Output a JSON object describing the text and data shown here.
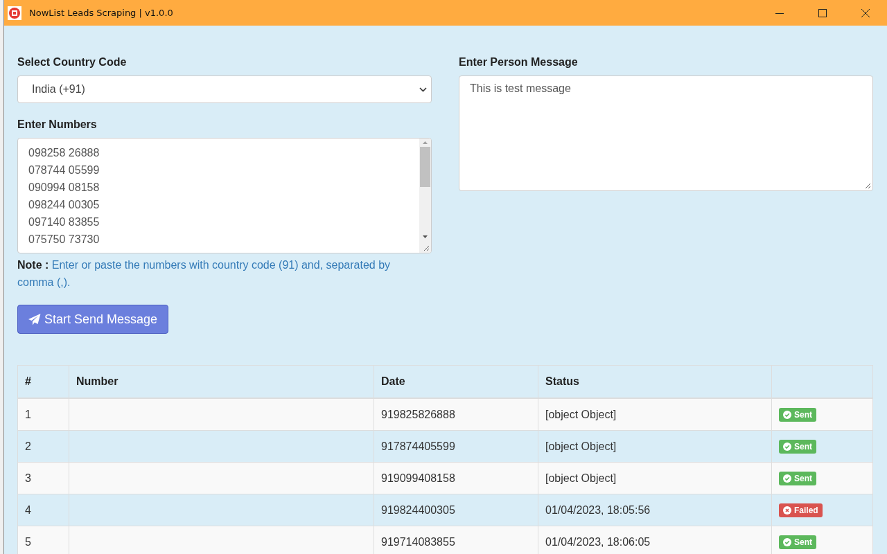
{
  "window": {
    "title": "NowList Leads Scraping | v1.0.0"
  },
  "country": {
    "label": "Select Country Code",
    "value": "India (+91)"
  },
  "numbers": {
    "label": "Enter Numbers",
    "lines": [
      "098258 26888",
      "078744 05599",
      "090994 08158",
      "098244 00305",
      "097140 83855",
      "075750 73730"
    ]
  },
  "note": {
    "label": "Note :",
    "text": "Enter or paste the numbers with country code (91) and, separated by comma (,)."
  },
  "send_button": "Start Send Message",
  "message": {
    "label": "Enter Person Message",
    "value": "This is test message"
  },
  "table": {
    "columns": [
      "#",
      "Number",
      "Date",
      "Status"
    ],
    "rows": [
      {
        "index": "1",
        "number": "",
        "date": "919825826888",
        "status": "[object Object]",
        "badge": {
          "kind": "sent",
          "label": "Sent"
        }
      },
      {
        "index": "2",
        "number": "",
        "date": "917874405599",
        "status": "[object Object]",
        "badge": {
          "kind": "sent",
          "label": "Sent"
        }
      },
      {
        "index": "3",
        "number": "",
        "date": "919099408158",
        "status": "[object Object]",
        "badge": {
          "kind": "sent",
          "label": "Sent"
        }
      },
      {
        "index": "4",
        "number": "",
        "date": "919824400305",
        "status": "01/04/2023, 18:05:56",
        "badge": {
          "kind": "failed",
          "label": "Failed"
        }
      },
      {
        "index": "5",
        "number": "",
        "date": "919714083855",
        "status": "01/04/2023, 18:06:05",
        "badge": {
          "kind": "sent",
          "label": "Sent"
        }
      }
    ]
  }
}
